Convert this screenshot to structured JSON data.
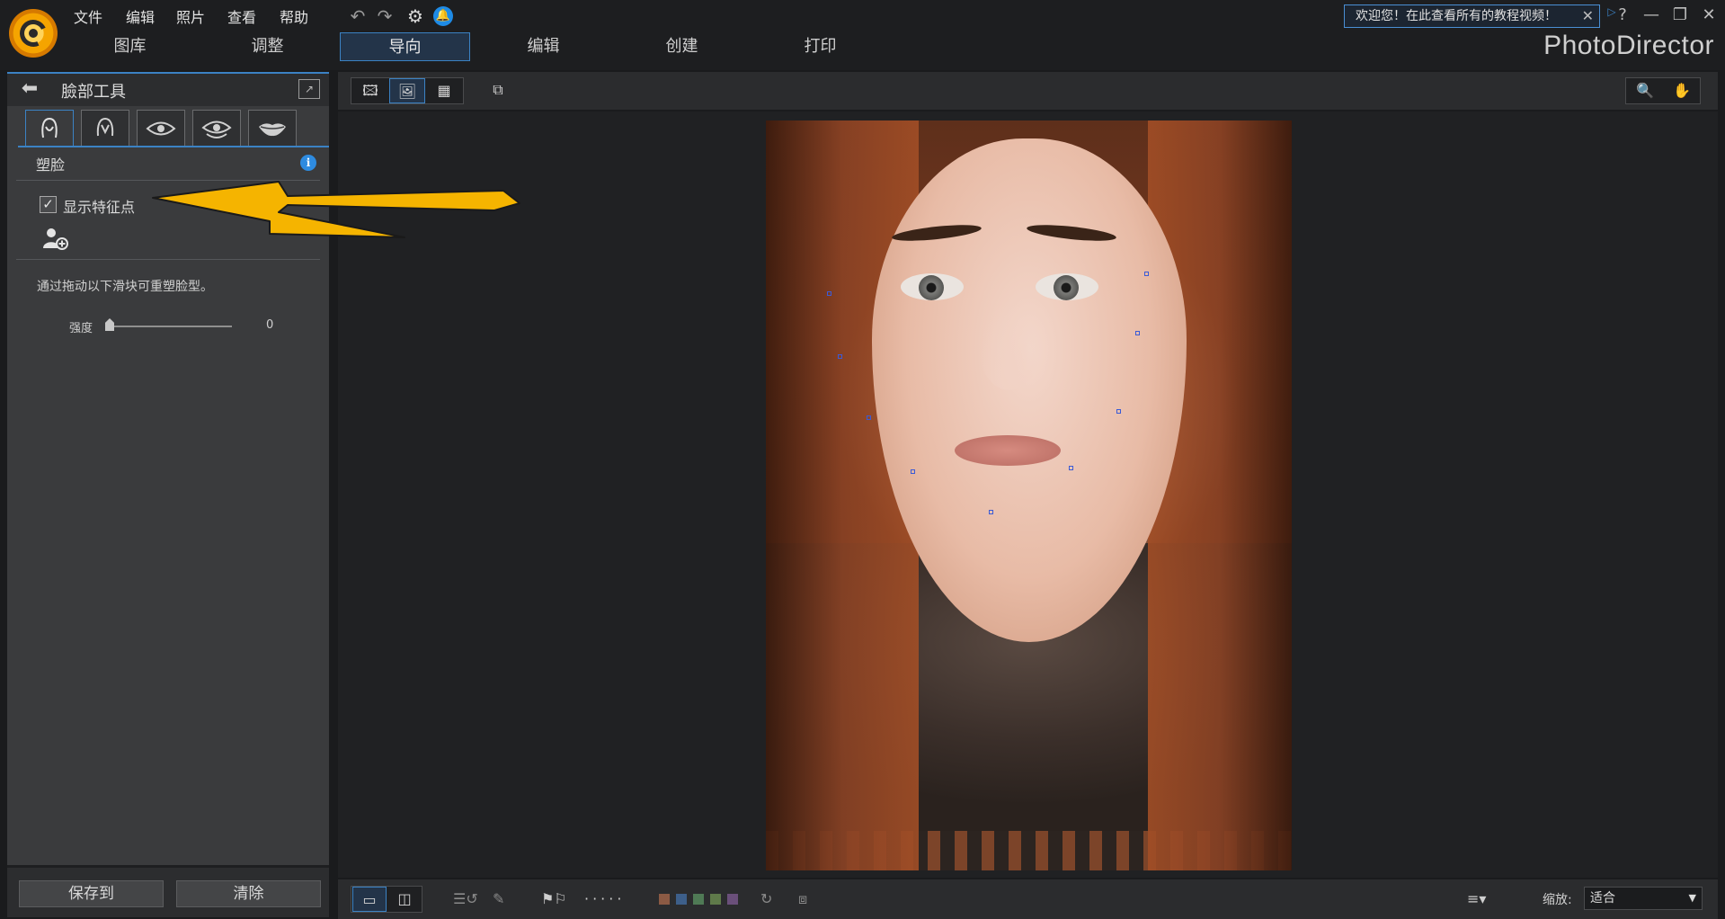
{
  "menu": [
    "文件",
    "编辑",
    "照片",
    "查看",
    "帮助"
  ],
  "main_tabs": [
    "图库",
    "调整",
    "导向",
    "编辑",
    "创建",
    "打印"
  ],
  "active_tab_index": 2,
  "welcome": {
    "text": "欢迎您！在此查看所有的教程视频！"
  },
  "window_controls": {
    "help": "?",
    "minimize": "—",
    "restore": "❐",
    "close": "✕"
  },
  "brand": "PhotoDirector",
  "panel": {
    "title": "臉部工具",
    "section_title": "塑脸",
    "show_landmarks_label": "显示特征点",
    "show_landmarks_checked": true,
    "hint": "通过拖动以下滑块可重塑脸型。",
    "strength_label": "强度",
    "strength_value": "0",
    "save_label": "保存到",
    "clear_label": "清除"
  },
  "face_tabs": [
    "face-shape-icon",
    "skin-icon",
    "eye-icon",
    "eye-bag-icon",
    "lips-icon"
  ],
  "viewer": {
    "zoom_label": "缩放:",
    "zoom_value": "适合"
  },
  "colors": {
    "accent": "#3b82c4",
    "annotation_arrow": "#f5b400",
    "landmark": "#3b5bd6",
    "swatches": [
      "#8b5a44",
      "#3d5f8a",
      "#4f7a55",
      "#5f7a4a",
      "#6a4f7a"
    ]
  }
}
